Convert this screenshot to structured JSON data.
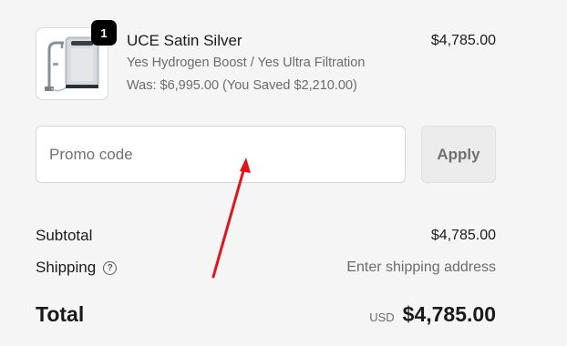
{
  "line_item": {
    "quantity": "1",
    "name": "UCE Satin Silver",
    "variant": "Yes Hydrogen Boost / Yes Ultra Filtration",
    "was_price": "Was: $6,995.00 (You Saved $2,210.00)",
    "price": "$4,785.00",
    "thumbnail_icon": "water-system-product-image"
  },
  "promo": {
    "placeholder": "Promo code",
    "value": "",
    "apply_label": "Apply"
  },
  "summary": {
    "subtotal_label": "Subtotal",
    "subtotal_value": "$4,785.00",
    "shipping_label": "Shipping",
    "shipping_help_icon": "?",
    "shipping_value": "Enter shipping address",
    "total_label": "Total",
    "currency": "USD",
    "total_value": "$4,785.00"
  },
  "colors": {
    "background": "#f5f5f5",
    "annotation_arrow": "#e0141e",
    "badge": "#000000",
    "muted_text": "#6b6b6b"
  }
}
